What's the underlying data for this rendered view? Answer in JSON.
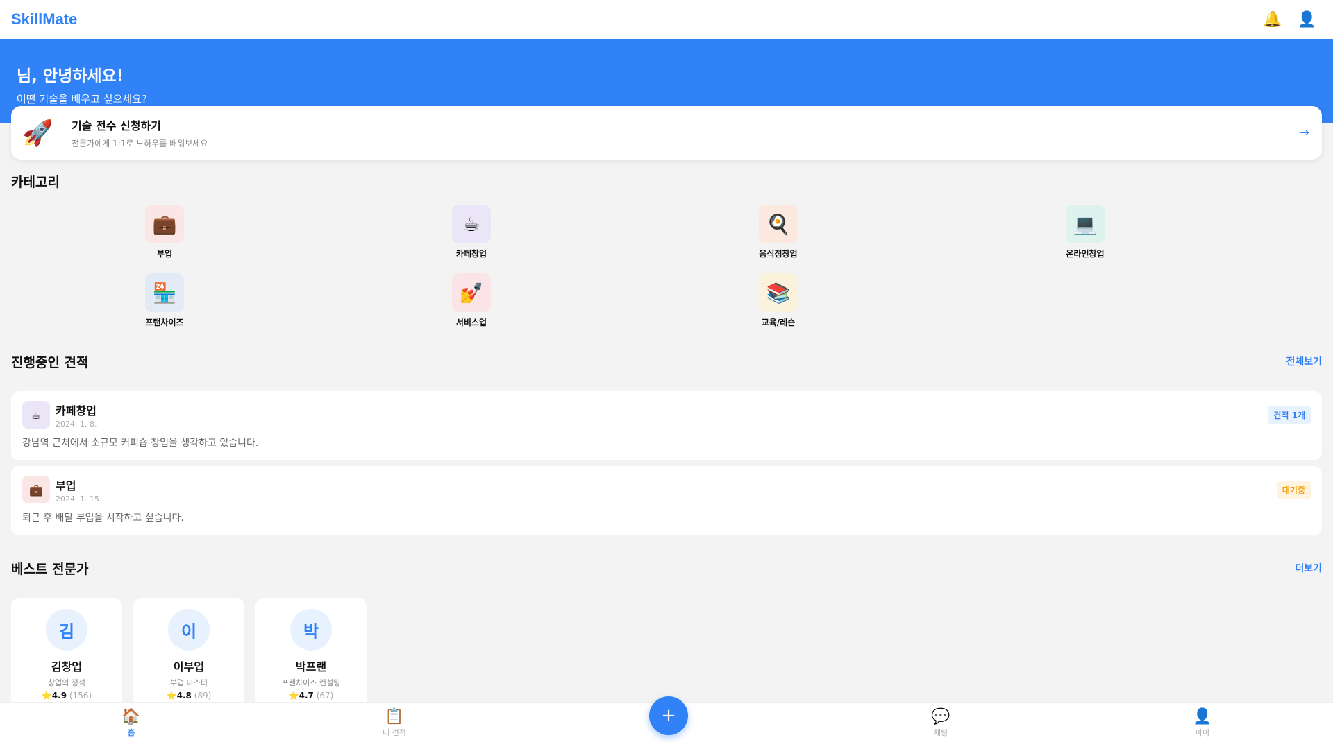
{
  "header": {
    "logo": "SkillMate",
    "bell_icon": "🔔",
    "profile_icon": "👤"
  },
  "hero": {
    "greeting": "님, 안녕하세요!",
    "subtitle": "어떤 기술을 배우고 싶으세요?"
  },
  "cta": {
    "icon": "🚀",
    "title": "기술 전수 신청하기",
    "subtitle": "전문가에게 1:1로 노하우를 배워보세요",
    "arrow": "→"
  },
  "categories": {
    "title": "카테고리",
    "items": [
      {
        "label": "부업",
        "icon": "💼",
        "bg": "#fbe6e6"
      },
      {
        "label": "카페창업",
        "icon": "☕",
        "bg": "#ebe6f7"
      },
      {
        "label": "음식점창업",
        "icon": "🍳",
        "bg": "#fbe9df"
      },
      {
        "label": "온라인창업",
        "icon": "💻",
        "bg": "#def3ee"
      },
      {
        "label": "프랜차이즈",
        "icon": "🏪",
        "bg": "#e2ebf5"
      },
      {
        "label": "서비스업",
        "icon": "💅",
        "bg": "#fbe4e8"
      },
      {
        "label": "교육/레슨",
        "icon": "📚",
        "bg": "#fbf2dc"
      }
    ]
  },
  "quotes": {
    "title": "진행중인 견적",
    "view_all": "전체보기",
    "items": [
      {
        "icon": "☕",
        "icon_bg": "#ebe6f7",
        "title": "카페창업",
        "date": "2024. 1. 8.",
        "badge": "견적 1개",
        "badge_color": "#3182f6",
        "badge_bg": "#e8f1fe",
        "desc": "강남역 근처에서 소규모 커피숍 창업을 생각하고 있습니다."
      },
      {
        "icon": "💼",
        "icon_bg": "#fbe6e6",
        "title": "부업",
        "date": "2024. 1. 15.",
        "badge": "대기중",
        "badge_color": "#f59e0b",
        "badge_bg": "#fff4e0",
        "desc": "퇴근 후 배달 부업을 시작하고 싶습니다."
      }
    ]
  },
  "experts": {
    "title": "베스트 전문가",
    "more": "더보기",
    "star": "⭐",
    "items": [
      {
        "initial": "김",
        "name": "김창업",
        "role": "창업의 정석",
        "rating": "4.9",
        "count": "(156)"
      },
      {
        "initial": "이",
        "name": "이부업",
        "role": "부업 마스터",
        "rating": "4.8",
        "count": "(89)"
      },
      {
        "initial": "박",
        "name": "박프랜",
        "role": "프랜차이즈 컨설팅",
        "rating": "4.7",
        "count": "(67)"
      }
    ]
  },
  "bottom_nav": {
    "items": [
      {
        "icon": "🏠",
        "label": "홈"
      },
      {
        "icon": "📋",
        "label": "내 견적"
      },
      {
        "icon": "💬",
        "label": "채팅"
      },
      {
        "icon": "👤",
        "label": "마이"
      }
    ],
    "fab": "+"
  }
}
